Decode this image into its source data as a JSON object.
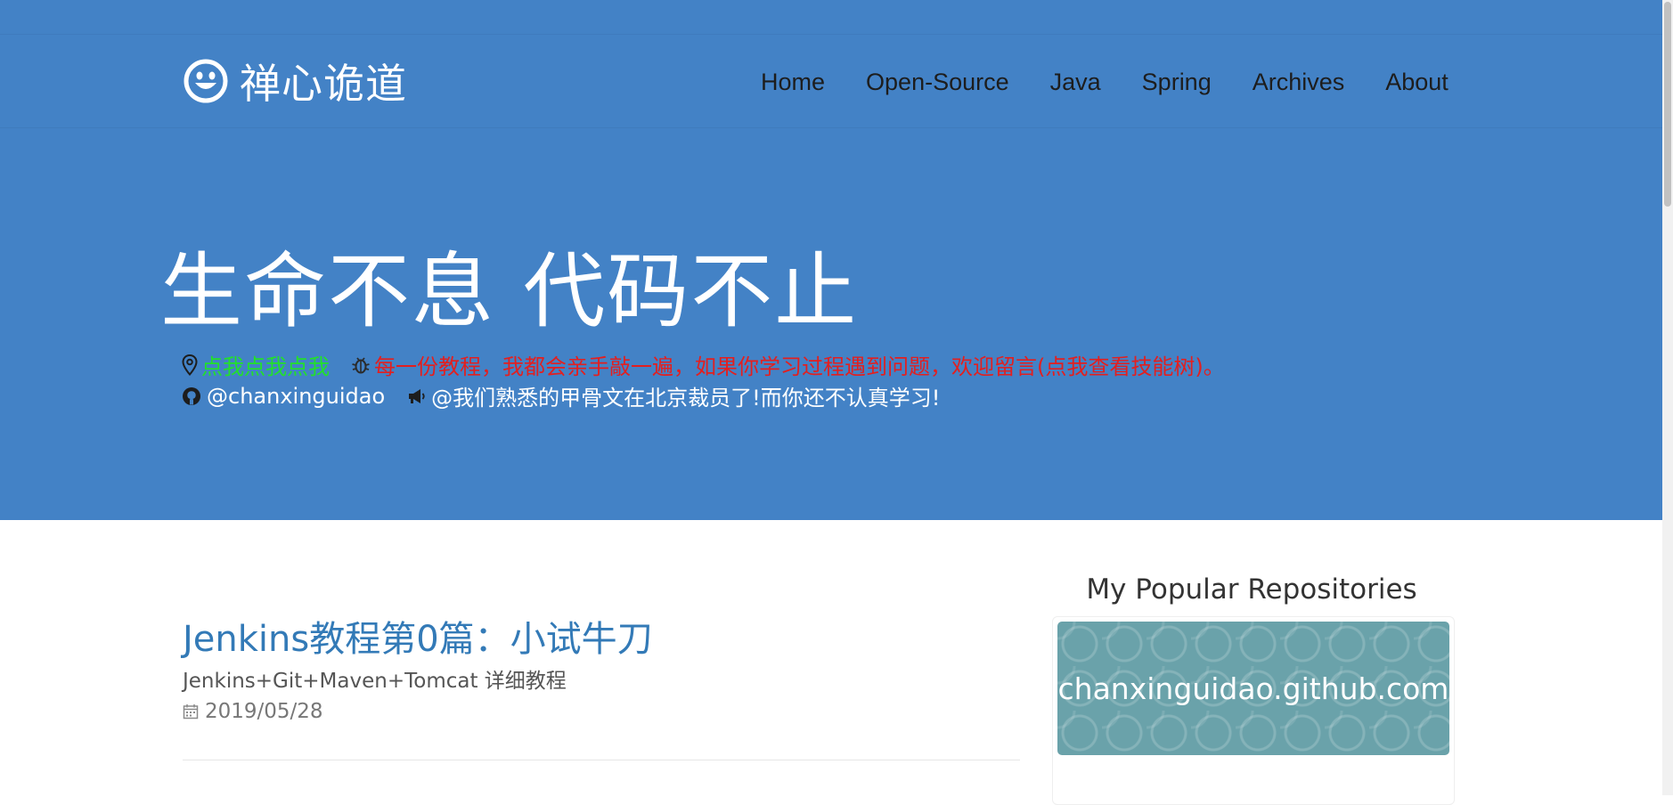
{
  "site": {
    "brand_name": "禅心诡道",
    "nav": [
      "Home",
      "Open-Source",
      "Java",
      "Spring",
      "Archives",
      "About"
    ]
  },
  "hero": {
    "title": "生命不息 代码不止",
    "location_link": "点我点我点我",
    "tutorial_notice": "每一份教程，我都会亲手敲一遍，如果你学习过程遇到问题，欢迎留言(点我查看技能树)。",
    "github_handle": "@chanxinguidao",
    "announcement": "@我们熟悉的甲骨文在北京裁员了!而你还不认真学习!"
  },
  "post": {
    "title": "Jenkins教程第0篇：小试牛刀",
    "subtitle": "Jenkins+Git+Maven+Tomcat 详细教程",
    "date": "2019/05/28"
  },
  "sidebar": {
    "title": "My Popular Repositories",
    "repo_name": "chanxinguidao.github.com"
  },
  "colors": {
    "header_bg": "#4382c6",
    "link_green": "#22e02c",
    "notice_red": "#e31f1f",
    "post_link": "#337ab7",
    "repo_bg": "#6aa2aa"
  },
  "icons": [
    "smile-icon",
    "map-marker-icon",
    "bug-icon",
    "github-icon",
    "megaphone-icon",
    "calendar-icon"
  ]
}
